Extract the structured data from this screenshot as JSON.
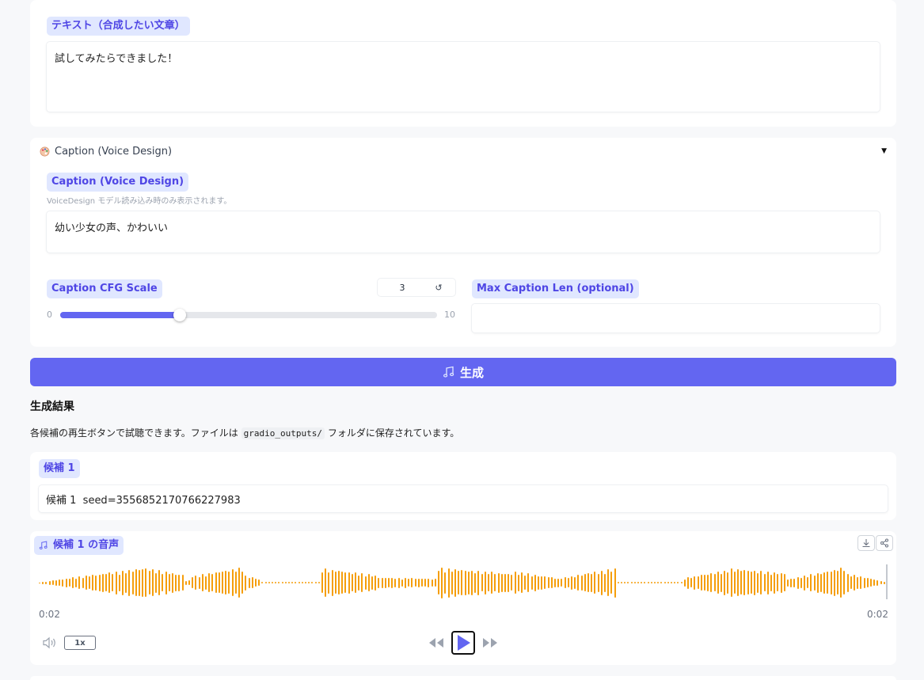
{
  "text_section": {
    "label": "テキスト（合成したい文章）",
    "value": "試してみたらできました！"
  },
  "caption_section": {
    "header_icon": "palette-icon",
    "header_title": "Caption (Voice Design)",
    "collapse_indicator": "▼",
    "caption_label": "Caption (Voice Design)",
    "caption_info": "VoiceDesign モデル読み込み時のみ表示されます。",
    "caption_value": "幼い少女の声、かわいい",
    "cfg_label": "Caption CFG Scale",
    "cfg_value": "3",
    "cfg_min": "0",
    "cfg_max": "10",
    "cfg_fraction": 0.3,
    "reset_icon": "↺",
    "max_len_label": "Max Caption Len (optional)",
    "max_len_value": ""
  },
  "generate_button": {
    "icon": "music-note-icon",
    "label": "生成"
  },
  "results": {
    "heading": "生成結果",
    "desc_before": "各候補の再生ボタンで試聴できます。ファイルは",
    "desc_code": "gradio_outputs/",
    "desc_after": "フォルダに保存されています。"
  },
  "candidate": {
    "label": "候補 1",
    "value": "候補 1  seed=3556852170766227983"
  },
  "audio": {
    "label": "候補 1 の音声",
    "time_current": "0:02",
    "time_total": "0:02",
    "speed": "1x",
    "accent": "#f59e0b"
  }
}
